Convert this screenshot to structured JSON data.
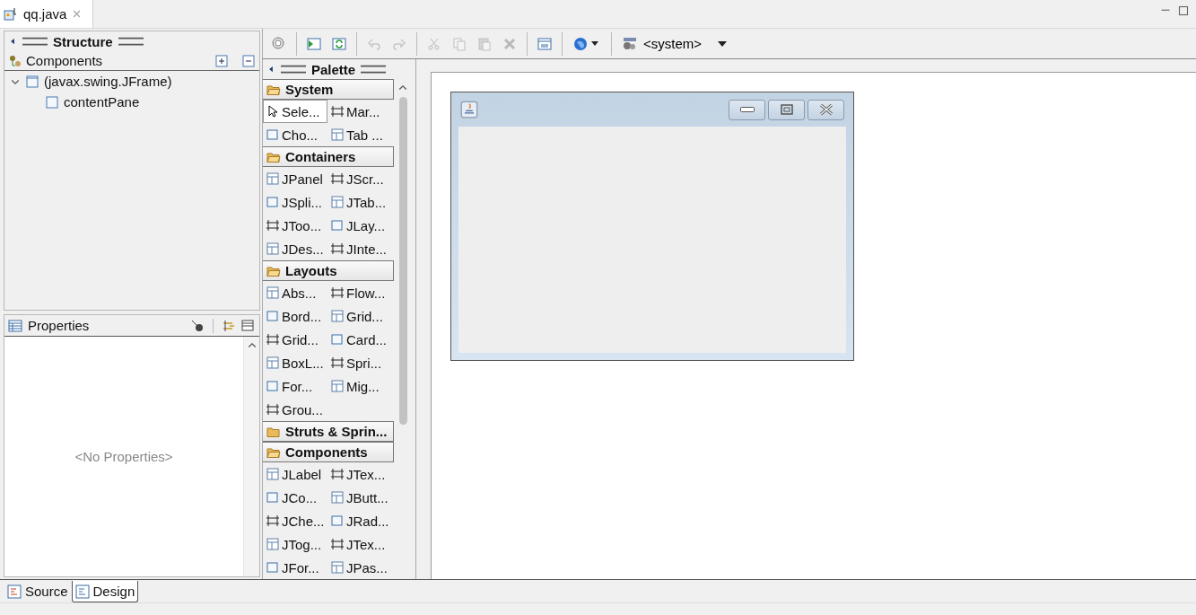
{
  "editor_tab": {
    "title": "qq.java"
  },
  "structure": {
    "title": "Structure",
    "components_title": "Components",
    "tree": [
      {
        "label": "(javax.swing.JFrame)",
        "expanded": true,
        "children": [
          {
            "label": "contentPane"
          }
        ]
      }
    ]
  },
  "properties": {
    "title": "Properties",
    "empty_text": "<No Properties>"
  },
  "toolbar": {
    "groups": [
      [
        {
          "disabled": false
        }
      ],
      [
        {
          "disabled": false
        },
        {
          "disabled": false
        }
      ],
      [
        {
          "disabled": true
        },
        {
          "disabled": true
        }
      ],
      [
        {
          "disabled": true
        },
        {
          "disabled": true
        },
        {
          "disabled": true
        },
        {
          "disabled": true
        }
      ],
      [
        {
          "disabled": false
        }
      ]
    ],
    "system_label": "<system>"
  },
  "palette": {
    "title": "Palette",
    "groups": [
      {
        "name": "System",
        "expanded": true,
        "items": [
          {
            "label": "Sele...",
            "selected": true
          },
          {
            "label": "Mar...",
            "selected": false
          },
          {
            "label": "Cho...",
            "selected": false
          },
          {
            "label": "Tab ...",
            "selected": false
          }
        ]
      },
      {
        "name": "Containers",
        "expanded": true,
        "items": [
          {
            "label": "JPanel",
            "selected": false
          },
          {
            "label": "JScr...",
            "selected": false
          },
          {
            "label": "JSpli...",
            "selected": false
          },
          {
            "label": "JTab...",
            "selected": false
          },
          {
            "label": "JToo...",
            "selected": false
          },
          {
            "label": "JLay...",
            "selected": false
          },
          {
            "label": "JDes...",
            "selected": false
          },
          {
            "label": "JInte...",
            "selected": false
          }
        ]
      },
      {
        "name": "Layouts",
        "expanded": true,
        "items": [
          {
            "label": "Abs...",
            "selected": false
          },
          {
            "label": "Flow...",
            "selected": false
          },
          {
            "label": "Bord...",
            "selected": false
          },
          {
            "label": "Grid...",
            "selected": false
          },
          {
            "label": "Grid...",
            "selected": false
          },
          {
            "label": "Card...",
            "selected": false
          },
          {
            "label": "BoxL...",
            "selected": false
          },
          {
            "label": "Spri...",
            "selected": false
          },
          {
            "label": "For...",
            "selected": false
          },
          {
            "label": "Mig...",
            "selected": false
          },
          {
            "label": "Grou...",
            "selected": false
          }
        ]
      },
      {
        "name": "Struts & Sprin...",
        "expanded": false
      },
      {
        "name": "Components",
        "expanded": true,
        "items": [
          {
            "label": "JLabel",
            "selected": false
          },
          {
            "label": "JTex...",
            "selected": false
          },
          {
            "label": "JCo...",
            "selected": false
          },
          {
            "label": "JButt...",
            "selected": false
          },
          {
            "label": "JChe...",
            "selected": false
          },
          {
            "label": "JRad...",
            "selected": false
          },
          {
            "label": "JTog...",
            "selected": false
          },
          {
            "label": "JTex...",
            "selected": false
          },
          {
            "label": "JFor...",
            "selected": false
          },
          {
            "label": "JPas...",
            "selected": false
          }
        ]
      }
    ]
  },
  "bottom_tabs": [
    {
      "label": "Source",
      "selected": false
    },
    {
      "label": "Design",
      "selected": true
    }
  ]
}
